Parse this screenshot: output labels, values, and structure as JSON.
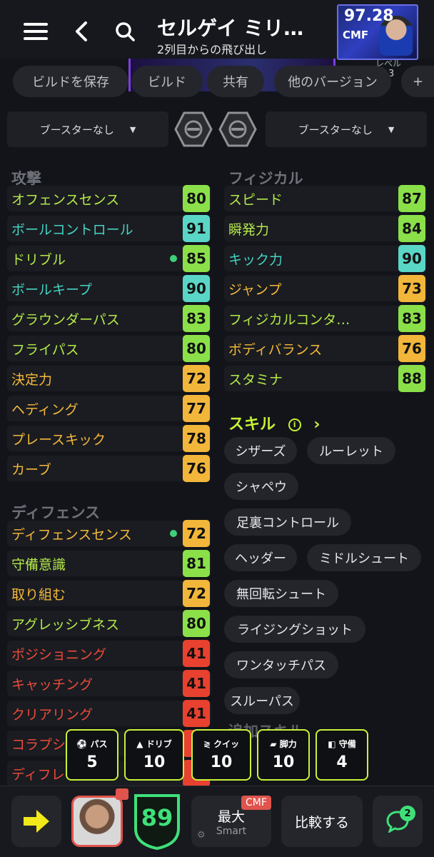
{
  "header": {
    "title": "セルゲイ ミリ…",
    "subtitle": "2列目からの飛び出し",
    "card_rating": "97.28",
    "card_position": "CMF",
    "level_label": "レベル",
    "level_value": "3"
  },
  "build_chips": [
    "ビルドを保存",
    "ビルド",
    "共有",
    "他のバージョン",
    "+"
  ],
  "boosters": {
    "left": "ブースターなし",
    "right": "ブースターなし"
  },
  "attack": {
    "title": "攻撃",
    "stats": [
      {
        "label": "オフェンスセンス",
        "value": "80",
        "label_color": "#b5e94a",
        "value_color": "#8be04a",
        "dot": false
      },
      {
        "label": "ボールコントロール",
        "value": "91",
        "label_color": "#46d3c2",
        "value_color": "#5ad6c7",
        "dot": false
      },
      {
        "label": "ドリブル",
        "value": "85",
        "label_color": "#b5e94a",
        "value_color": "#8be04a",
        "dot": true
      },
      {
        "label": "ボールキープ",
        "value": "90",
        "label_color": "#46d3c2",
        "value_color": "#5ad6c7",
        "dot": false
      },
      {
        "label": "グラウンダーパス",
        "value": "83",
        "label_color": "#b5e94a",
        "value_color": "#8be04a",
        "dot": false
      },
      {
        "label": "フライパス",
        "value": "80",
        "label_color": "#b5e94a",
        "value_color": "#8be04a",
        "dot": false
      },
      {
        "label": "決定力",
        "value": "72",
        "label_color": "#f5b93b",
        "value_color": "#f2b63a",
        "dot": false
      },
      {
        "label": "ヘディング",
        "value": "77",
        "label_color": "#f5b93b",
        "value_color": "#f2b63a",
        "dot": false
      },
      {
        "label": "プレースキック",
        "value": "78",
        "label_color": "#f5b93b",
        "value_color": "#f2b63a",
        "dot": false
      },
      {
        "label": "カーブ",
        "value": "76",
        "label_color": "#f5b93b",
        "value_color": "#f2b63a",
        "dot": false
      }
    ]
  },
  "defense": {
    "title": "ディフェンス",
    "stats": [
      {
        "label": "ディフェンスセンス",
        "value": "72",
        "label_color": "#f5b93b",
        "value_color": "#f2b63a",
        "dot": true
      },
      {
        "label": "守備意識",
        "value": "81",
        "label_color": "#b5e94a",
        "value_color": "#8be04a",
        "dot": false
      },
      {
        "label": "取り組む",
        "value": "72",
        "label_color": "#f5b93b",
        "value_color": "#f2b63a",
        "dot": false
      },
      {
        "label": "アグレッシブネス",
        "value": "80",
        "label_color": "#b5e94a",
        "value_color": "#8be04a",
        "dot": false
      },
      {
        "label": "ポジショニング",
        "value": "41",
        "label_color": "#ee4a3a",
        "value_color": "#e8412f",
        "dot": false
      },
      {
        "label": "キャッチング",
        "value": "41",
        "label_color": "#ee4a3a",
        "value_color": "#e8412f",
        "dot": false
      },
      {
        "label": "クリアリング",
        "value": "41",
        "label_color": "#ee4a3a",
        "value_color": "#e8412f",
        "dot": false
      },
      {
        "label": "コラプシ",
        "value": "",
        "label_color": "#ee4a3a",
        "value_color": "#e8412f",
        "dot": false
      },
      {
        "label": "ディフレ",
        "value": "",
        "label_color": "#ee4a3a",
        "value_color": "#e8412f",
        "dot": false
      }
    ]
  },
  "physical": {
    "title": "フィジカル",
    "stats": [
      {
        "label": "スピード",
        "value": "87",
        "label_color": "#b5e94a",
        "value_color": "#8be04a",
        "dot": false
      },
      {
        "label": "瞬発力",
        "value": "84",
        "label_color": "#b5e94a",
        "value_color": "#8be04a",
        "dot": false
      },
      {
        "label": "キック力",
        "value": "90",
        "label_color": "#46d3c2",
        "value_color": "#5ad6c7",
        "dot": false
      },
      {
        "label": "ジャンプ",
        "value": "73",
        "label_color": "#f5b93b",
        "value_color": "#f2b63a",
        "dot": false
      },
      {
        "label": "フィジカルコンタ…",
        "value": "83",
        "label_color": "#b5e94a",
        "value_color": "#8be04a",
        "dot": false
      },
      {
        "label": "ボディバランス",
        "value": "76",
        "label_color": "#f5b93b",
        "value_color": "#f2b63a",
        "dot": false
      },
      {
        "label": "スタミナ",
        "value": "88",
        "label_color": "#b5e94a",
        "value_color": "#8be04a",
        "dot": false
      }
    ]
  },
  "skills": {
    "title": "スキル",
    "items": [
      "シザーズ",
      "ルーレット",
      "シャペウ",
      "足裏コントロール",
      "ヘッダー",
      "ミドルシュート",
      "無回転シュート",
      "ライジングショット",
      "ワンタッチパス",
      "スルーパス"
    ],
    "additional_title": "追加スキル"
  },
  "tiles": [
    {
      "icon": "ball-icon",
      "label": "パス",
      "value": "5"
    },
    {
      "icon": "cone-icon",
      "label": "ドリブ",
      "value": "10"
    },
    {
      "icon": "quick-icon",
      "label": "クイッ",
      "value": "10"
    },
    {
      "icon": "boot-icon",
      "label": "脚力",
      "value": "10"
    },
    {
      "icon": "shield-icon",
      "label": "守備",
      "value": "4"
    }
  ],
  "bottom": {
    "overall": "89",
    "mode_label": "最大",
    "mode_sub": "Smart",
    "mode_badge": "CMF",
    "compare_label": "比較する",
    "chat_badge": "2"
  }
}
